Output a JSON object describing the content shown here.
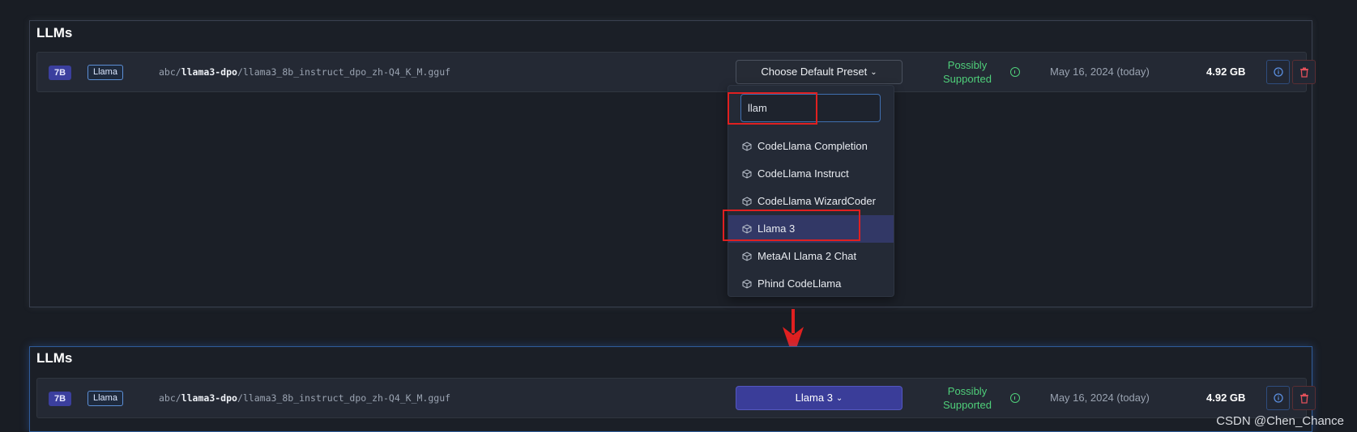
{
  "top_panel": {
    "title": "LLMs",
    "row": {
      "size_badge": "7B",
      "arch_badge": "Llama",
      "path_prefix": "abc/",
      "path_repo": "llama3-dpo",
      "path_file": "/llama3_8b_instruct_dpo_zh-Q4_K_M.gguf",
      "preset_label": "Choose Default Preset",
      "support_line1": "Possibly",
      "support_line2": "Supported",
      "date": "May 16, 2024 (today)",
      "file_size": "4.92 GB"
    },
    "dropdown": {
      "search_value": "llam",
      "items": [
        {
          "label": "CodeLlama Completion",
          "icon": "cube-icon"
        },
        {
          "label": "CodeLlama Instruct",
          "icon": "cube-icon"
        },
        {
          "label": "CodeLlama WizardCoder",
          "icon": "cube-icon"
        },
        {
          "label": "Llama 3",
          "icon": "cube-icon"
        },
        {
          "label": "MetaAI Llama 2 Chat",
          "icon": "cube-icon"
        },
        {
          "label": "Phind CodeLlama",
          "icon": "cube-icon"
        }
      ],
      "highlighted_index": 3
    }
  },
  "bottom_panel": {
    "title": "LLMs",
    "row": {
      "size_badge": "7B",
      "arch_badge": "Llama",
      "path_prefix": "abc/",
      "path_repo": "llama3-dpo",
      "path_file": "/llama3_8b_instruct_dpo_zh-Q4_K_M.gguf",
      "preset_label": "Llama 3",
      "support_line1": "Possibly",
      "support_line2": "Supported",
      "date": "May 16, 2024 (today)",
      "file_size": "4.92 GB"
    }
  },
  "watermark": "CSDN @Chen_Chance",
  "colors": {
    "background": "#191d24",
    "accent_green": "#4fcf7a",
    "selected_preset": "#3a3d99",
    "annotation_red": "#e02020"
  }
}
